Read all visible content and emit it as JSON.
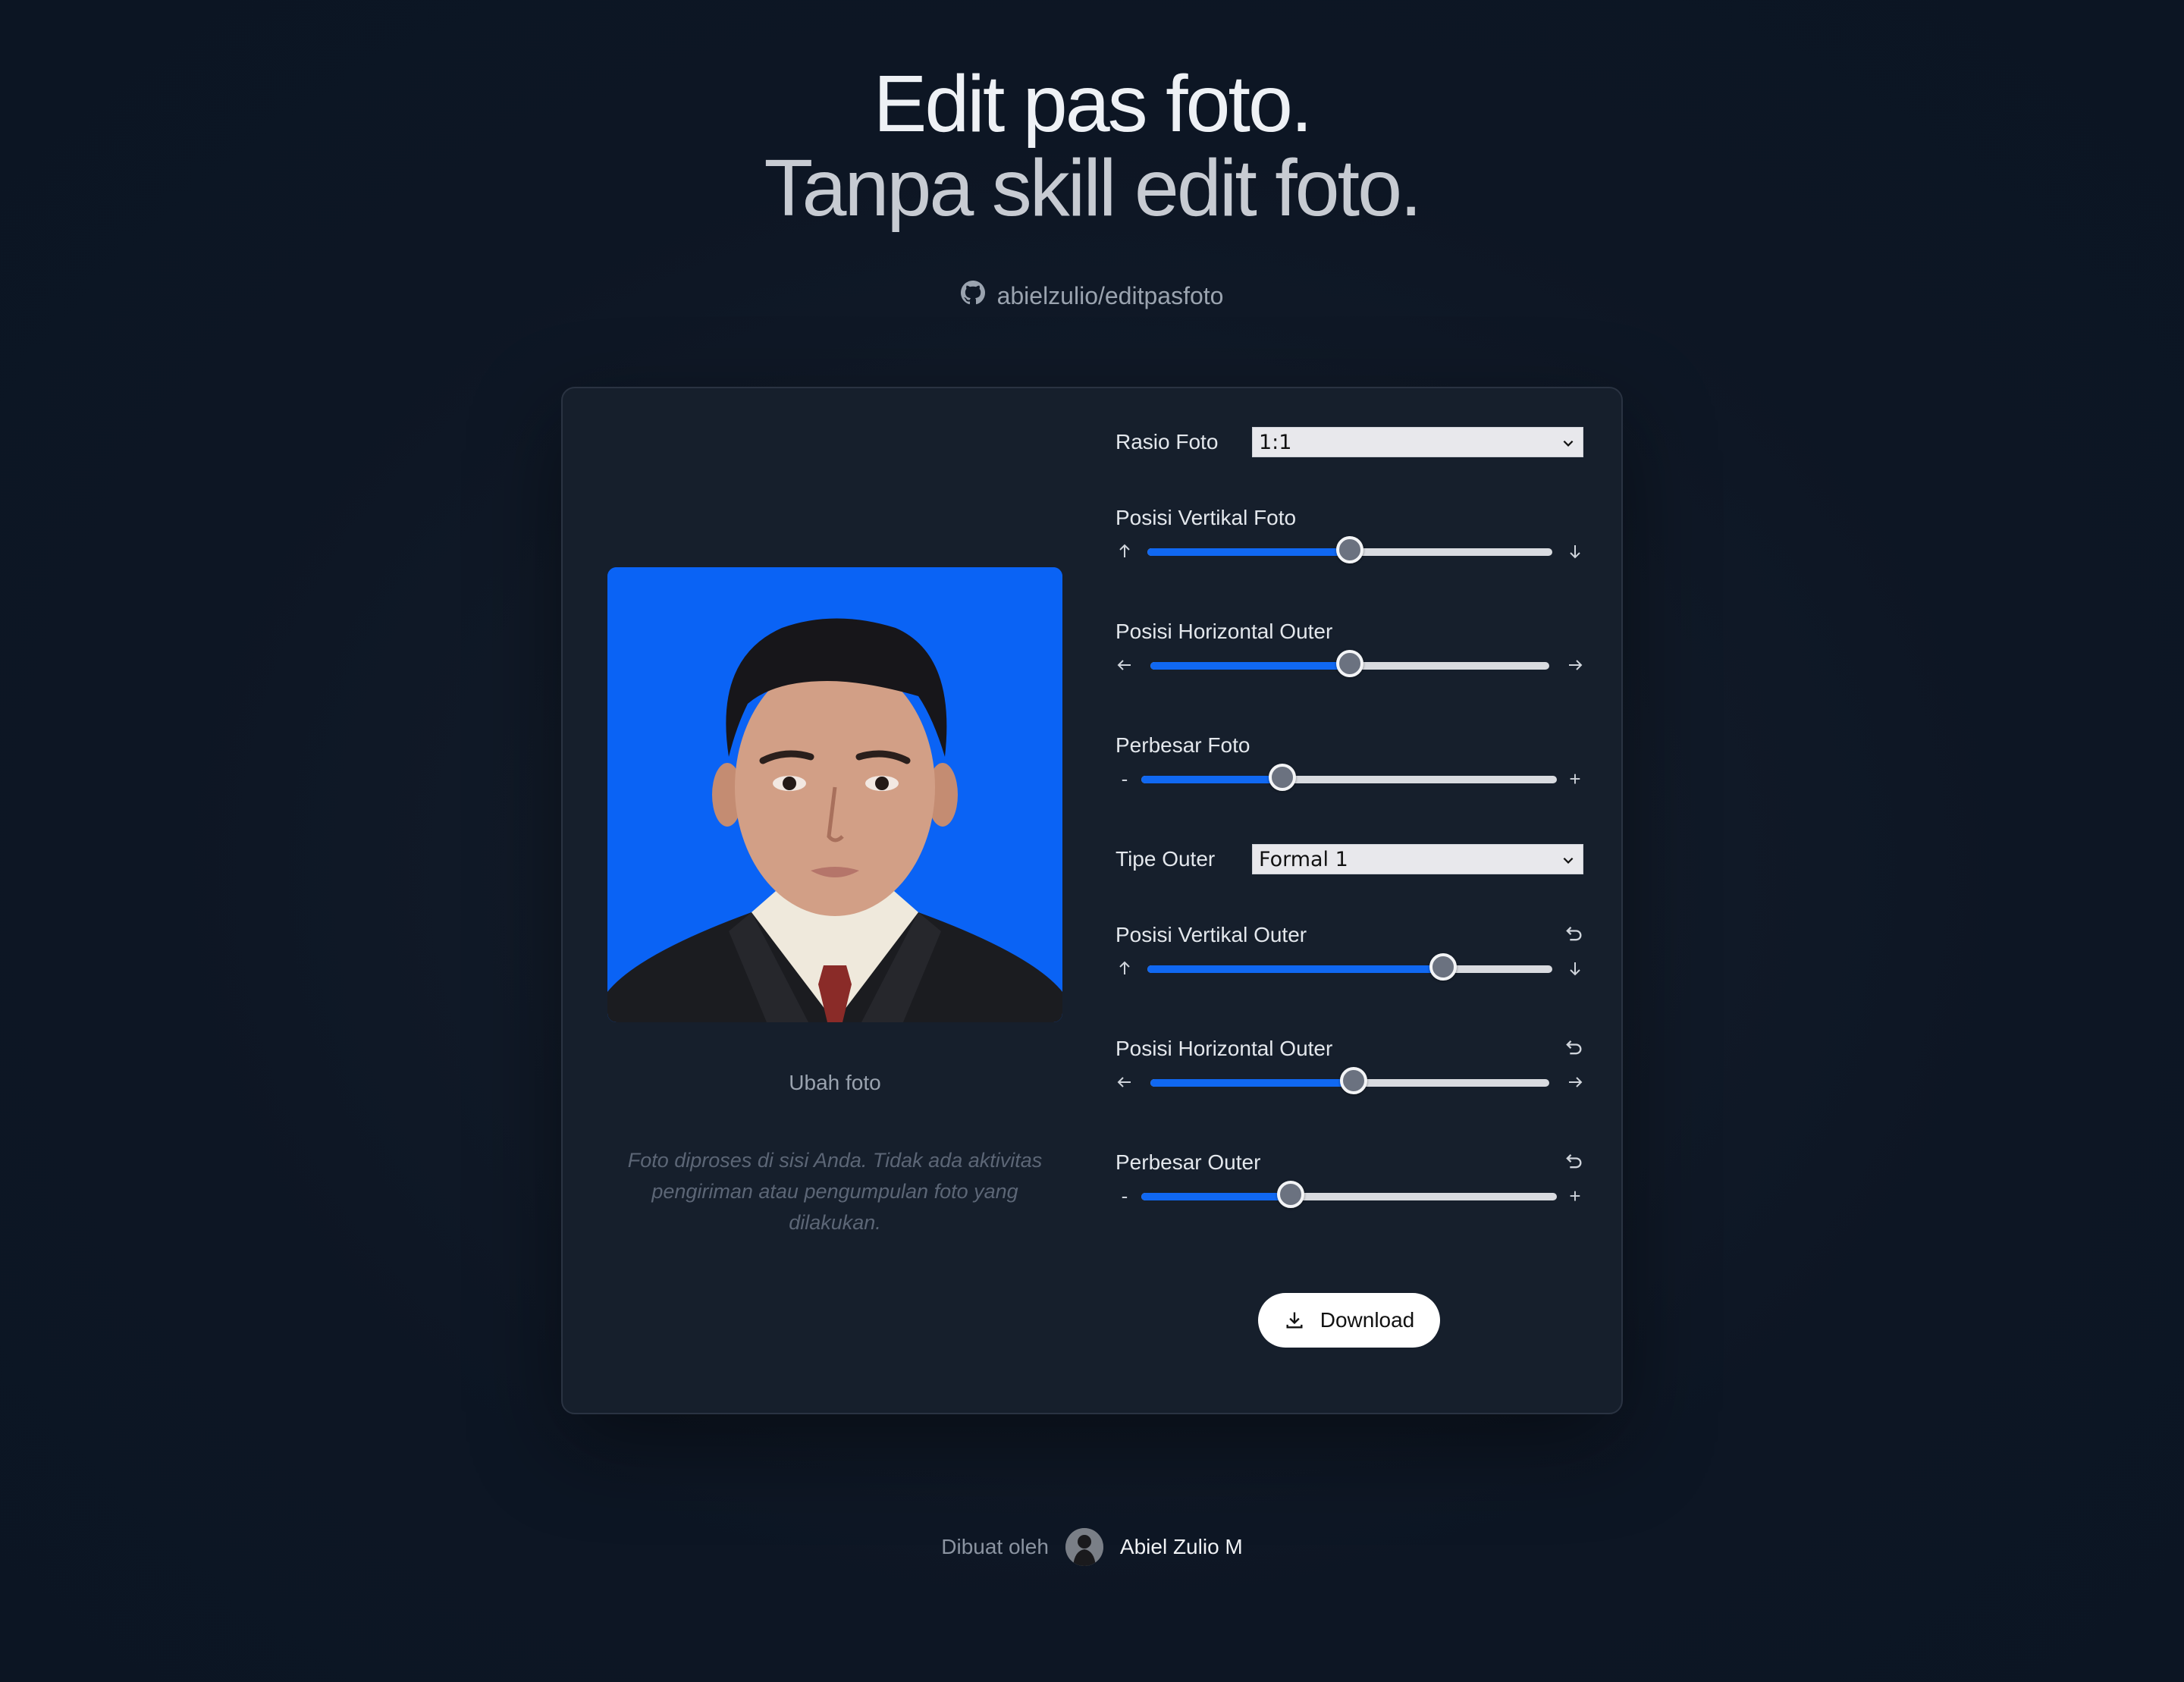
{
  "hero": {
    "line1": "Edit pas foto.",
    "line2": "Tanpa skill edit foto."
  },
  "repo": {
    "icon": "github-icon",
    "label": "abielzulio/editpasfoto"
  },
  "photo_panel": {
    "change_photo": "Ubah foto",
    "privacy_note": "Foto diproses di sisi Anda. Tidak ada aktivitas pengiriman atau pengumpulan foto yang dilakukan."
  },
  "controls": {
    "ratio": {
      "label": "Rasio Foto",
      "value": "1:1"
    },
    "photo_vertical": {
      "label": "Posisi Vertikal Foto",
      "left": "↑",
      "right": "↓",
      "value": 0.5
    },
    "photo_horizontal": {
      "label": "Posisi Horizontal Outer",
      "left": "←",
      "right": "→",
      "value": 0.5
    },
    "photo_zoom": {
      "label": "Perbesar Foto",
      "left": "-",
      "right": "+",
      "value": 0.34
    },
    "outer_type": {
      "label": "Tipe Outer",
      "value": "Formal 1"
    },
    "outer_vertical": {
      "label": "Posisi Vertikal Outer",
      "left": "↑",
      "right": "↓",
      "value": 0.73
    },
    "outer_horizontal": {
      "label": "Posisi Horizontal Outer",
      "left": "←",
      "right": "→",
      "value": 0.51
    },
    "outer_zoom": {
      "label": "Perbesar Outer",
      "left": "-",
      "right": "+",
      "value": 0.36
    }
  },
  "download": {
    "label": "Download"
  },
  "footer": {
    "made_by": "Dibuat oleh",
    "author": "Abiel Zulio M"
  },
  "colors": {
    "background": "#0c1523",
    "card": "#161f2c",
    "accent": "#1068f2",
    "photo_bg": "#0a63f5"
  }
}
